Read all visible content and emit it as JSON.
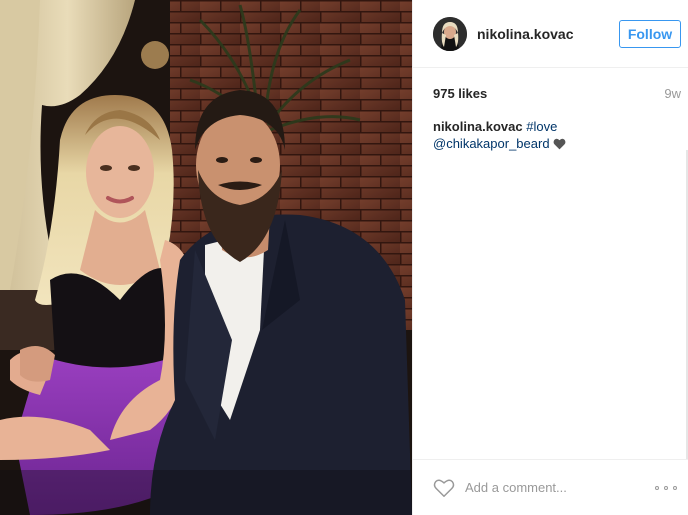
{
  "post": {
    "username": "nikolina.kovac",
    "follow_label": "Follow",
    "likes": "975 likes",
    "time_ago": "9w",
    "caption": {
      "user": "nikolina.kovac",
      "hashtag": "#love",
      "mention": "@chikakapor_beard"
    },
    "comment_placeholder": "Add a comment..."
  },
  "icons": {
    "like": "heart-outline-icon",
    "more": "more-options-icon",
    "caption_emoji": "black-heart-icon"
  },
  "colors": {
    "accent": "#3897f0",
    "link": "#003569",
    "muted": "#999999"
  }
}
